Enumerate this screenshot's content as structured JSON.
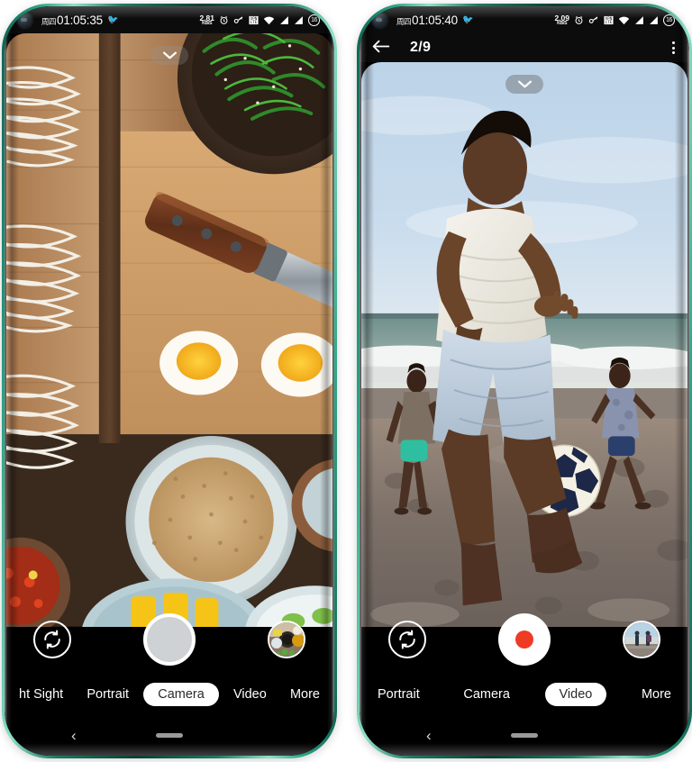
{
  "phones": [
    {
      "id": "camera-phone",
      "status_bar": {
        "day": "周四",
        "clock": "01:05:35",
        "net_speed_value": "2.81",
        "net_speed_unit": "KB/S",
        "icons": [
          "alarm-icon",
          "key-icon",
          "vpn-icon",
          "wifi-icon",
          "signal-icon",
          "signal-icon"
        ],
        "battery_level": "16"
      },
      "viewfinder": {
        "scene": "food-flatlay-noodles-eggs-spinach",
        "chevron": "chevron-down-icon"
      },
      "controls": {
        "flip_icon": "camera-flip-icon",
        "shutter_label": "shutter-button",
        "thumbnail": "spices-bowls-thumbnail"
      },
      "modes": [
        {
          "label": "ht Sight",
          "active": false
        },
        {
          "label": "Portrait",
          "active": false
        },
        {
          "label": "Camera",
          "active": true
        },
        {
          "label": "Video",
          "active": false
        },
        {
          "label": "More",
          "active": false
        }
      ],
      "nav": {
        "back": "‹",
        "home": "home-pill"
      }
    },
    {
      "id": "video-phone",
      "status_bar": {
        "day": "周四",
        "clock": "01:05:40",
        "net_speed_value": "2.09",
        "net_speed_unit": "KB/S",
        "icons": [
          "alarm-icon",
          "key-icon",
          "vpn-icon",
          "wifi-icon",
          "signal-icon",
          "signal-icon"
        ],
        "battery_level": "16"
      },
      "gallery_header": {
        "back_icon": "arrow-left-icon",
        "title": "2/9",
        "menu_icon": "overflow-menu-icon"
      },
      "viewfinder": {
        "scene": "beach-football-players",
        "chevron": "chevron-down-icon"
      },
      "controls": {
        "flip_icon": "camera-flip-icon",
        "record_label": "record-button",
        "thumbnail": "beach-walkers-thumbnail"
      },
      "modes": [
        {
          "label": "Portrait",
          "active": false
        },
        {
          "label": "Camera",
          "active": false
        },
        {
          "label": "Video",
          "active": true
        },
        {
          "label": "More",
          "active": false
        }
      ],
      "nav": {
        "back": "‹",
        "home": "home-pill"
      }
    }
  ],
  "colors": {
    "frame_green": "#1d7a63",
    "record_red": "#ee3b24",
    "active_pill": "#ffffff",
    "status_bg": "#0c0c0c"
  }
}
